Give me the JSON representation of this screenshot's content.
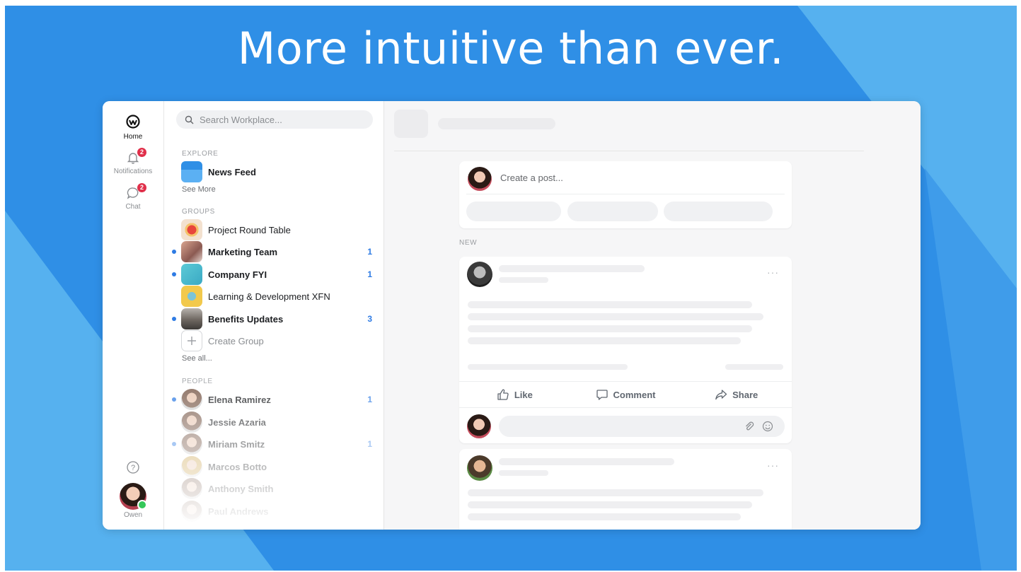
{
  "headline": "More intuitive than ever.",
  "rail": {
    "home_label": "Home",
    "notifications_label": "Notifications",
    "notifications_badge": "2",
    "chat_label": "Chat",
    "chat_badge": "2",
    "help_icon": "?",
    "user_label": "Owen"
  },
  "sidebar": {
    "search_placeholder": "Search Workplace...",
    "explore_header": "EXPLORE",
    "news_feed_label": "News Feed",
    "see_more_label": "See More",
    "groups_header": "GROUPS",
    "groups": [
      {
        "name": "Project Round Table",
        "count": "",
        "unread": false,
        "bold": false
      },
      {
        "name": "Marketing Team",
        "count": "1",
        "unread": true,
        "bold": true
      },
      {
        "name": "Company FYI",
        "count": "1",
        "unread": true,
        "bold": true
      },
      {
        "name": "Learning & Development XFN",
        "count": "",
        "unread": false,
        "bold": false
      },
      {
        "name": "Benefits Updates",
        "count": "3",
        "unread": true,
        "bold": true
      }
    ],
    "create_group_label": "Create Group",
    "see_all_label": "See all...",
    "people_header": "PEOPLE",
    "people": [
      {
        "name": "Elena Ramirez",
        "count": "1",
        "unread": true
      },
      {
        "name": "Jessie Azaria",
        "count": "",
        "unread": false
      },
      {
        "name": "Miriam Smitz",
        "count": "1",
        "unread": true
      },
      {
        "name": "Marcos Botto",
        "count": "",
        "unread": false
      },
      {
        "name": "Anthony Smith",
        "count": "",
        "unread": false
      },
      {
        "name": "Paul Andrews",
        "count": "",
        "unread": false
      }
    ]
  },
  "feed": {
    "composer_placeholder": "Create a post...",
    "new_section_label": "NEW",
    "like_label": "Like",
    "comment_label": "Comment",
    "share_label": "Share",
    "more_label": "···"
  },
  "colors": {
    "background_blue": "#2f8fe6",
    "background_light_blue": "#56b1ef",
    "accent_blue": "#2e7be4",
    "badge_red": "#e02f4a",
    "online_green": "#35c759"
  }
}
